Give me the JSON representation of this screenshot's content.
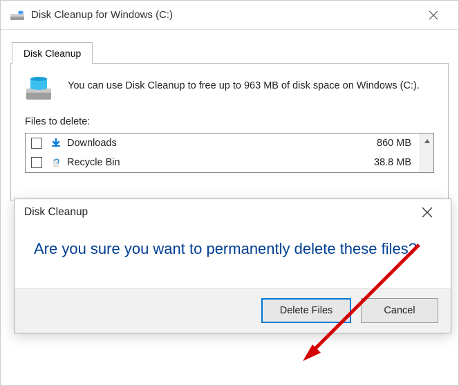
{
  "main": {
    "title": "Disk Cleanup for Windows (C:)",
    "tab_label": "Disk Cleanup",
    "info_text": "You can use Disk Cleanup to free up to 963 MB of disk space on Windows (C:).",
    "files_to_delete_label": "Files to delete:",
    "items": [
      {
        "label": "Downloads",
        "size": "860 MB"
      },
      {
        "label": "Recycle Bin",
        "size": "38.8 MB"
      }
    ]
  },
  "dialog": {
    "title": "Disk Cleanup",
    "question": "Are you sure you want to permanently delete these files?",
    "delete_label": "Delete Files",
    "cancel_label": "Cancel"
  }
}
